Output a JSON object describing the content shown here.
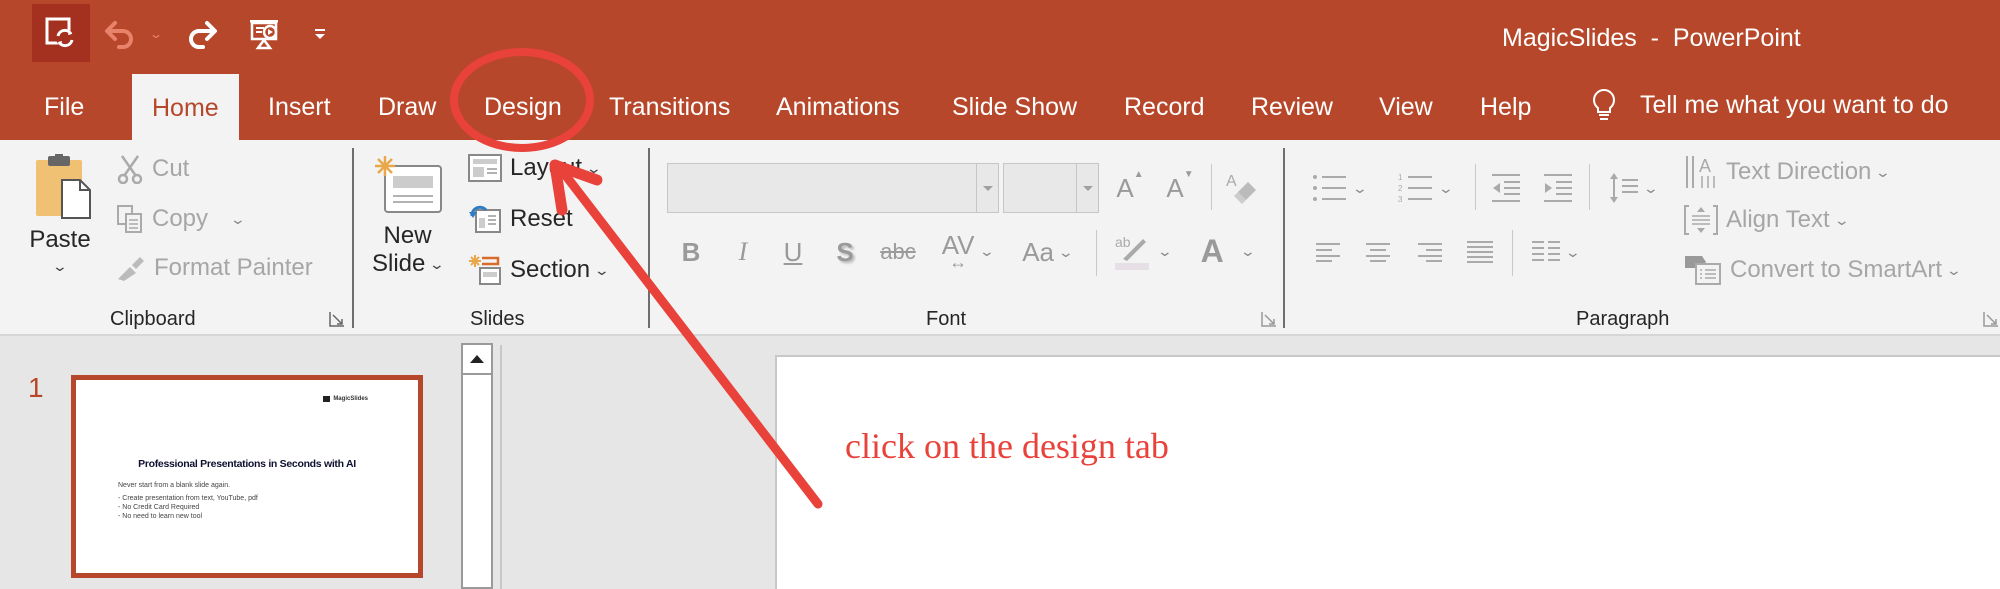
{
  "window": {
    "title": "MagicSlides  -  PowerPoint",
    "accent_color": "#B7472A"
  },
  "quick_access": {
    "autosave_icon": "autosave-sync-icon",
    "undo_icon": "undo-icon",
    "redo_icon": "redo-icon",
    "present_icon": "present-from-beginning-icon",
    "customize_icon": "customize-toolbar-icon"
  },
  "tabs": [
    {
      "label": "File"
    },
    {
      "label": "Home",
      "active": true
    },
    {
      "label": "Insert"
    },
    {
      "label": "Draw"
    },
    {
      "label": "Design"
    },
    {
      "label": "Transitions"
    },
    {
      "label": "Animations"
    },
    {
      "label": "Slide Show"
    },
    {
      "label": "Record"
    },
    {
      "label": "Review"
    },
    {
      "label": "View"
    },
    {
      "label": "Help"
    }
  ],
  "tell_me": {
    "label": "Tell me what you want to do",
    "icon": "lightbulb-icon"
  },
  "ribbon": {
    "clipboard": {
      "label": "Clipboard",
      "paste": "Paste",
      "cut": "Cut",
      "copy": "Copy",
      "format_painter": "Format Painter"
    },
    "slides": {
      "label": "Slides",
      "new_slide_line1": "New",
      "new_slide_line2": "Slide",
      "layout": "Layout",
      "reset": "Reset",
      "section": "Section"
    },
    "font": {
      "label": "Font",
      "font_name_value": "",
      "font_size_value": "",
      "bold": "B",
      "italic": "I",
      "underline": "U",
      "shadow": "S",
      "strikethrough": "abc",
      "char_spacing": "AV",
      "change_case": "Aa",
      "highlight": "ab",
      "font_color": "A",
      "grow": "A",
      "shrink": "A"
    },
    "paragraph": {
      "label": "Paragraph",
      "text_direction": "Text Direction",
      "align_text": "Align Text",
      "convert_smartart": "Convert to SmartArt"
    }
  },
  "slides_pane": {
    "slides": [
      {
        "number": "1",
        "logo_text": "MagicSlides",
        "title": "Professional Presentations in Seconds with AI",
        "subtitle": "Never start from a blank slide again.",
        "bullets": [
          "- Create presentation from text, YouTube, pdf",
          "- No Credit Card Required",
          "- No need to learn new tool"
        ]
      }
    ]
  },
  "annotation": {
    "text": "click on the design tab",
    "color": "#E8423A",
    "target": "Design"
  }
}
